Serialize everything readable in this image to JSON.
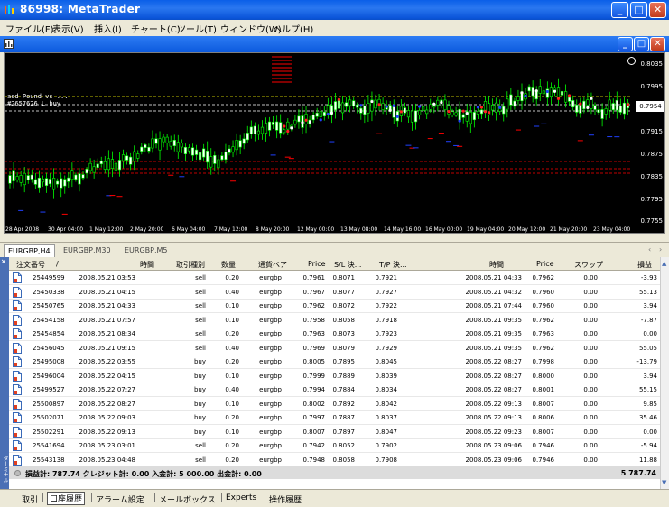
{
  "window": {
    "title": "86998: MetaTrader"
  },
  "menu": [
    "ファイル(F)",
    "表示(V)",
    "挿入(I)",
    "チャート(C)",
    "ツール(T)",
    "ウィンドウ(W)",
    "ヘルプ(H)"
  ],
  "chart": {
    "info_line1": "asd Pound vs ...",
    "info_line2": "#2657626 L buy",
    "price_labels": [
      "0.8035",
      "0.7995",
      "0.7954",
      "0.7915",
      "0.7875",
      "0.7835",
      "0.7795",
      "0.7755"
    ],
    "current_price": "0.7954",
    "time_labels": [
      "28 Apr 2008",
      "30 Apr 04:00",
      "1 May 12:00",
      "2 May 20:00",
      "6 May 04:00",
      "7 May 12:00",
      "8 May 20:00",
      "12 May 00:00",
      "13 May 08:00",
      "14 May 16:00",
      "16 May 00:00",
      "19 May 04:00",
      "20 May 12:00",
      "21 May 20:00",
      "23 May 04:00"
    ]
  },
  "chart_tabs": [
    "EURGBP,H4",
    "EURGBP,M30",
    "EURGBP,M5"
  ],
  "table": {
    "headers": {
      "order": "注文番号",
      "sort": "/",
      "time": "時間",
      "type": "取引種別",
      "qty": "数量",
      "pair": "通貨ペア",
      "price": "Price",
      "sl": "S/L 決...",
      "tp": "T/P 決...",
      "close_time": "時間",
      "close_price": "Price",
      "swap": "スワップ",
      "profit": "損益"
    },
    "rows": [
      {
        "order": "25449599",
        "time": "2008.05.21 03:53",
        "type": "sell",
        "qty": "0.20",
        "pair": "eurgbp",
        "price": "0.7961",
        "sl": "0.8071",
        "tp": "0.7921",
        "close_time": "2008.05.21 04:33",
        "close_price": "0.7962",
        "swap": "0.00",
        "profit": "-3.93"
      },
      {
        "order": "25450338",
        "time": "2008.05.21 04:15",
        "type": "sell",
        "qty": "0.40",
        "pair": "eurgbp",
        "price": "0.7967",
        "sl": "0.8077",
        "tp": "0.7927",
        "close_time": "2008.05.21 04:32",
        "close_price": "0.7960",
        "swap": "0.00",
        "profit": "55.13"
      },
      {
        "order": "25450765",
        "time": "2008.05.21 04:33",
        "type": "sell",
        "qty": "0.10",
        "pair": "eurgbp",
        "price": "0.7962",
        "sl": "0.8072",
        "tp": "0.7922",
        "close_time": "2008.05.21 07:44",
        "close_price": "0.7960",
        "swap": "0.00",
        "profit": "3.94"
      },
      {
        "order": "25454158",
        "time": "2008.05.21 07:57",
        "type": "sell",
        "qty": "0.10",
        "pair": "eurgbp",
        "price": "0.7958",
        "sl": "0.8058",
        "tp": "0.7918",
        "close_time": "2008.05.21 09:35",
        "close_price": "0.7962",
        "swap": "0.00",
        "profit": "-7.87"
      },
      {
        "order": "25454854",
        "time": "2008.05.21 08:34",
        "type": "sell",
        "qty": "0.20",
        "pair": "eurgbp",
        "price": "0.7963",
        "sl": "0.8073",
        "tp": "0.7923",
        "close_time": "2008.05.21 09:35",
        "close_price": "0.7963",
        "swap": "0.00",
        "profit": "0.00"
      },
      {
        "order": "25456045",
        "time": "2008.05.21 09:15",
        "type": "sell",
        "qty": "0.40",
        "pair": "eurgbp",
        "price": "0.7969",
        "sl": "0.8079",
        "tp": "0.7929",
        "close_time": "2008.05.21 09:35",
        "close_price": "0.7962",
        "swap": "0.00",
        "profit": "55.05"
      },
      {
        "order": "25495008",
        "time": "2008.05.22 03:55",
        "type": "buy",
        "qty": "0.20",
        "pair": "eurgbp",
        "price": "0.8005",
        "sl": "0.7895",
        "tp": "0.8045",
        "close_time": "2008.05.22 08:27",
        "close_price": "0.7998",
        "swap": "0.00",
        "profit": "-13.79"
      },
      {
        "order": "25496004",
        "time": "2008.05.22 04:15",
        "type": "buy",
        "qty": "0.10",
        "pair": "eurgbp",
        "price": "0.7999",
        "sl": "0.7889",
        "tp": "0.8039",
        "close_time": "2008.05.22 08:27",
        "close_price": "0.8000",
        "swap": "0.00",
        "profit": "3.94"
      },
      {
        "order": "25499527",
        "time": "2008.05.22 07:27",
        "type": "buy",
        "qty": "0.40",
        "pair": "eurgbp",
        "price": "0.7994",
        "sl": "0.7884",
        "tp": "0.8034",
        "close_time": "2008.05.22 08:27",
        "close_price": "0.8001",
        "swap": "0.00",
        "profit": "55.15"
      },
      {
        "order": "25500897",
        "time": "2008.05.22 08:27",
        "type": "buy",
        "qty": "0.10",
        "pair": "eurgbp",
        "price": "0.8002",
        "sl": "0.7892",
        "tp": "0.8042",
        "close_time": "2008.05.22 09:13",
        "close_price": "0.8007",
        "swap": "0.00",
        "profit": "9.85"
      },
      {
        "order": "25502071",
        "time": "2008.05.22 09:03",
        "type": "buy",
        "qty": "0.20",
        "pair": "eurgbp",
        "price": "0.7997",
        "sl": "0.7887",
        "tp": "0.8037",
        "close_time": "2008.05.22 09:13",
        "close_price": "0.8006",
        "swap": "0.00",
        "profit": "35.46"
      },
      {
        "order": "25502291",
        "time": "2008.05.22 09:13",
        "type": "buy",
        "qty": "0.10",
        "pair": "eurgbp",
        "price": "0.8007",
        "sl": "0.7897",
        "tp": "0.8047",
        "close_time": "2008.05.22 09:23",
        "close_price": "0.8007",
        "swap": "0.00",
        "profit": "0.00"
      },
      {
        "order": "25541694",
        "time": "2008.05.23 03:01",
        "type": "sell",
        "qty": "0.20",
        "pair": "eurgbp",
        "price": "0.7942",
        "sl": "0.8052",
        "tp": "0.7902",
        "close_time": "2008.05.23 09:06",
        "close_price": "0.7946",
        "swap": "0.00",
        "profit": "-5.94"
      },
      {
        "order": "25543138",
        "time": "2008.05.23 04:48",
        "type": "sell",
        "qty": "0.20",
        "pair": "eurgbp",
        "price": "0.7948",
        "sl": "0.8058",
        "tp": "0.7908",
        "close_time": "2008.05.23 09:06",
        "close_price": "0.7946",
        "swap": "0.00",
        "profit": "11.88"
      }
    ],
    "summary": "損益計: 787.74  クレジット計: 0.00  入金計: 5 000.00  出金計: 0.00",
    "summary_total": "5 787.74"
  },
  "side_label": "ターミナル",
  "bottom_tabs": [
    "取引",
    "口座履歴",
    "アラーム設定",
    "メールボックス",
    "Experts",
    "操作履歴"
  ]
}
